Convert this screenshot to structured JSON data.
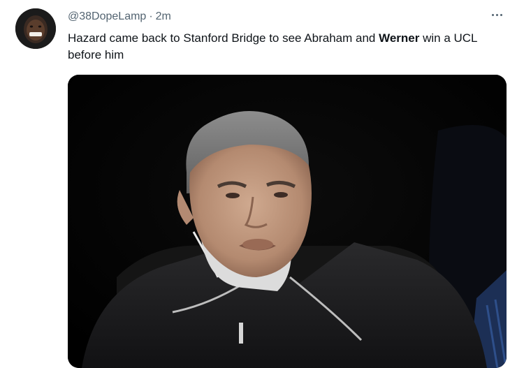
{
  "tweet": {
    "handle": "@38DopeLamp",
    "separator": "·",
    "time": "2m",
    "text_part1": "Hazard came back to Stanford Bridge to see Abraham and ",
    "text_bold": "Werner",
    "text_part2": " win a UCL before him"
  },
  "icons": {
    "avatar": "user-avatar",
    "more": "more-options-icon"
  },
  "colors": {
    "secondary_text": "#536471",
    "primary_text": "#0f1419"
  }
}
